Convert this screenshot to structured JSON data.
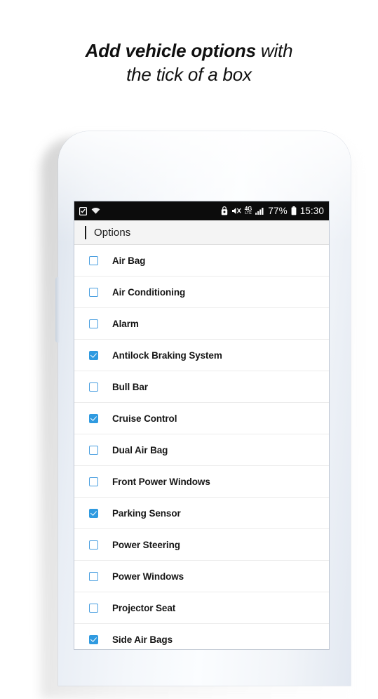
{
  "headline": {
    "line1_strong": "Add vehicle options",
    "line1_light": " with",
    "line2": "the tick of a box"
  },
  "phone": {
    "statusbar": {
      "left_icons": [
        "task-app-icon",
        "wifi-icon"
      ],
      "right_icons": [
        "security-lock-icon",
        "sound-mute-icon",
        "signal-bars-icon",
        "battery-icon"
      ],
      "network_label": "4G",
      "network_sublabel": "LTE",
      "battery_percent": "77%",
      "clock": "15:30"
    },
    "appbar": {
      "back_icon": "chevron-left-icon",
      "title": "Options"
    },
    "options": [
      {
        "label": "Air Bag",
        "checked": false
      },
      {
        "label": "Air Conditioning",
        "checked": false
      },
      {
        "label": "Alarm",
        "checked": false
      },
      {
        "label": "Antilock Braking System",
        "checked": true
      },
      {
        "label": "Bull Bar",
        "checked": false
      },
      {
        "label": "Cruise Control",
        "checked": true
      },
      {
        "label": "Dual Air Bag",
        "checked": false
      },
      {
        "label": "Front Power Windows",
        "checked": false
      },
      {
        "label": "Parking Sensor",
        "checked": true
      },
      {
        "label": "Power Steering",
        "checked": false
      },
      {
        "label": "Power Windows",
        "checked": false
      },
      {
        "label": "Projector Seat",
        "checked": false
      },
      {
        "label": "Side Air Bags",
        "checked": true
      }
    ]
  },
  "colors": {
    "checkbox_accent": "#2f9ae0",
    "checkbox_outline": "#4a9fe0",
    "statusbar_bg": "#0c0c0c",
    "appbar_bg": "#f4f4f4",
    "text": "#161616"
  }
}
